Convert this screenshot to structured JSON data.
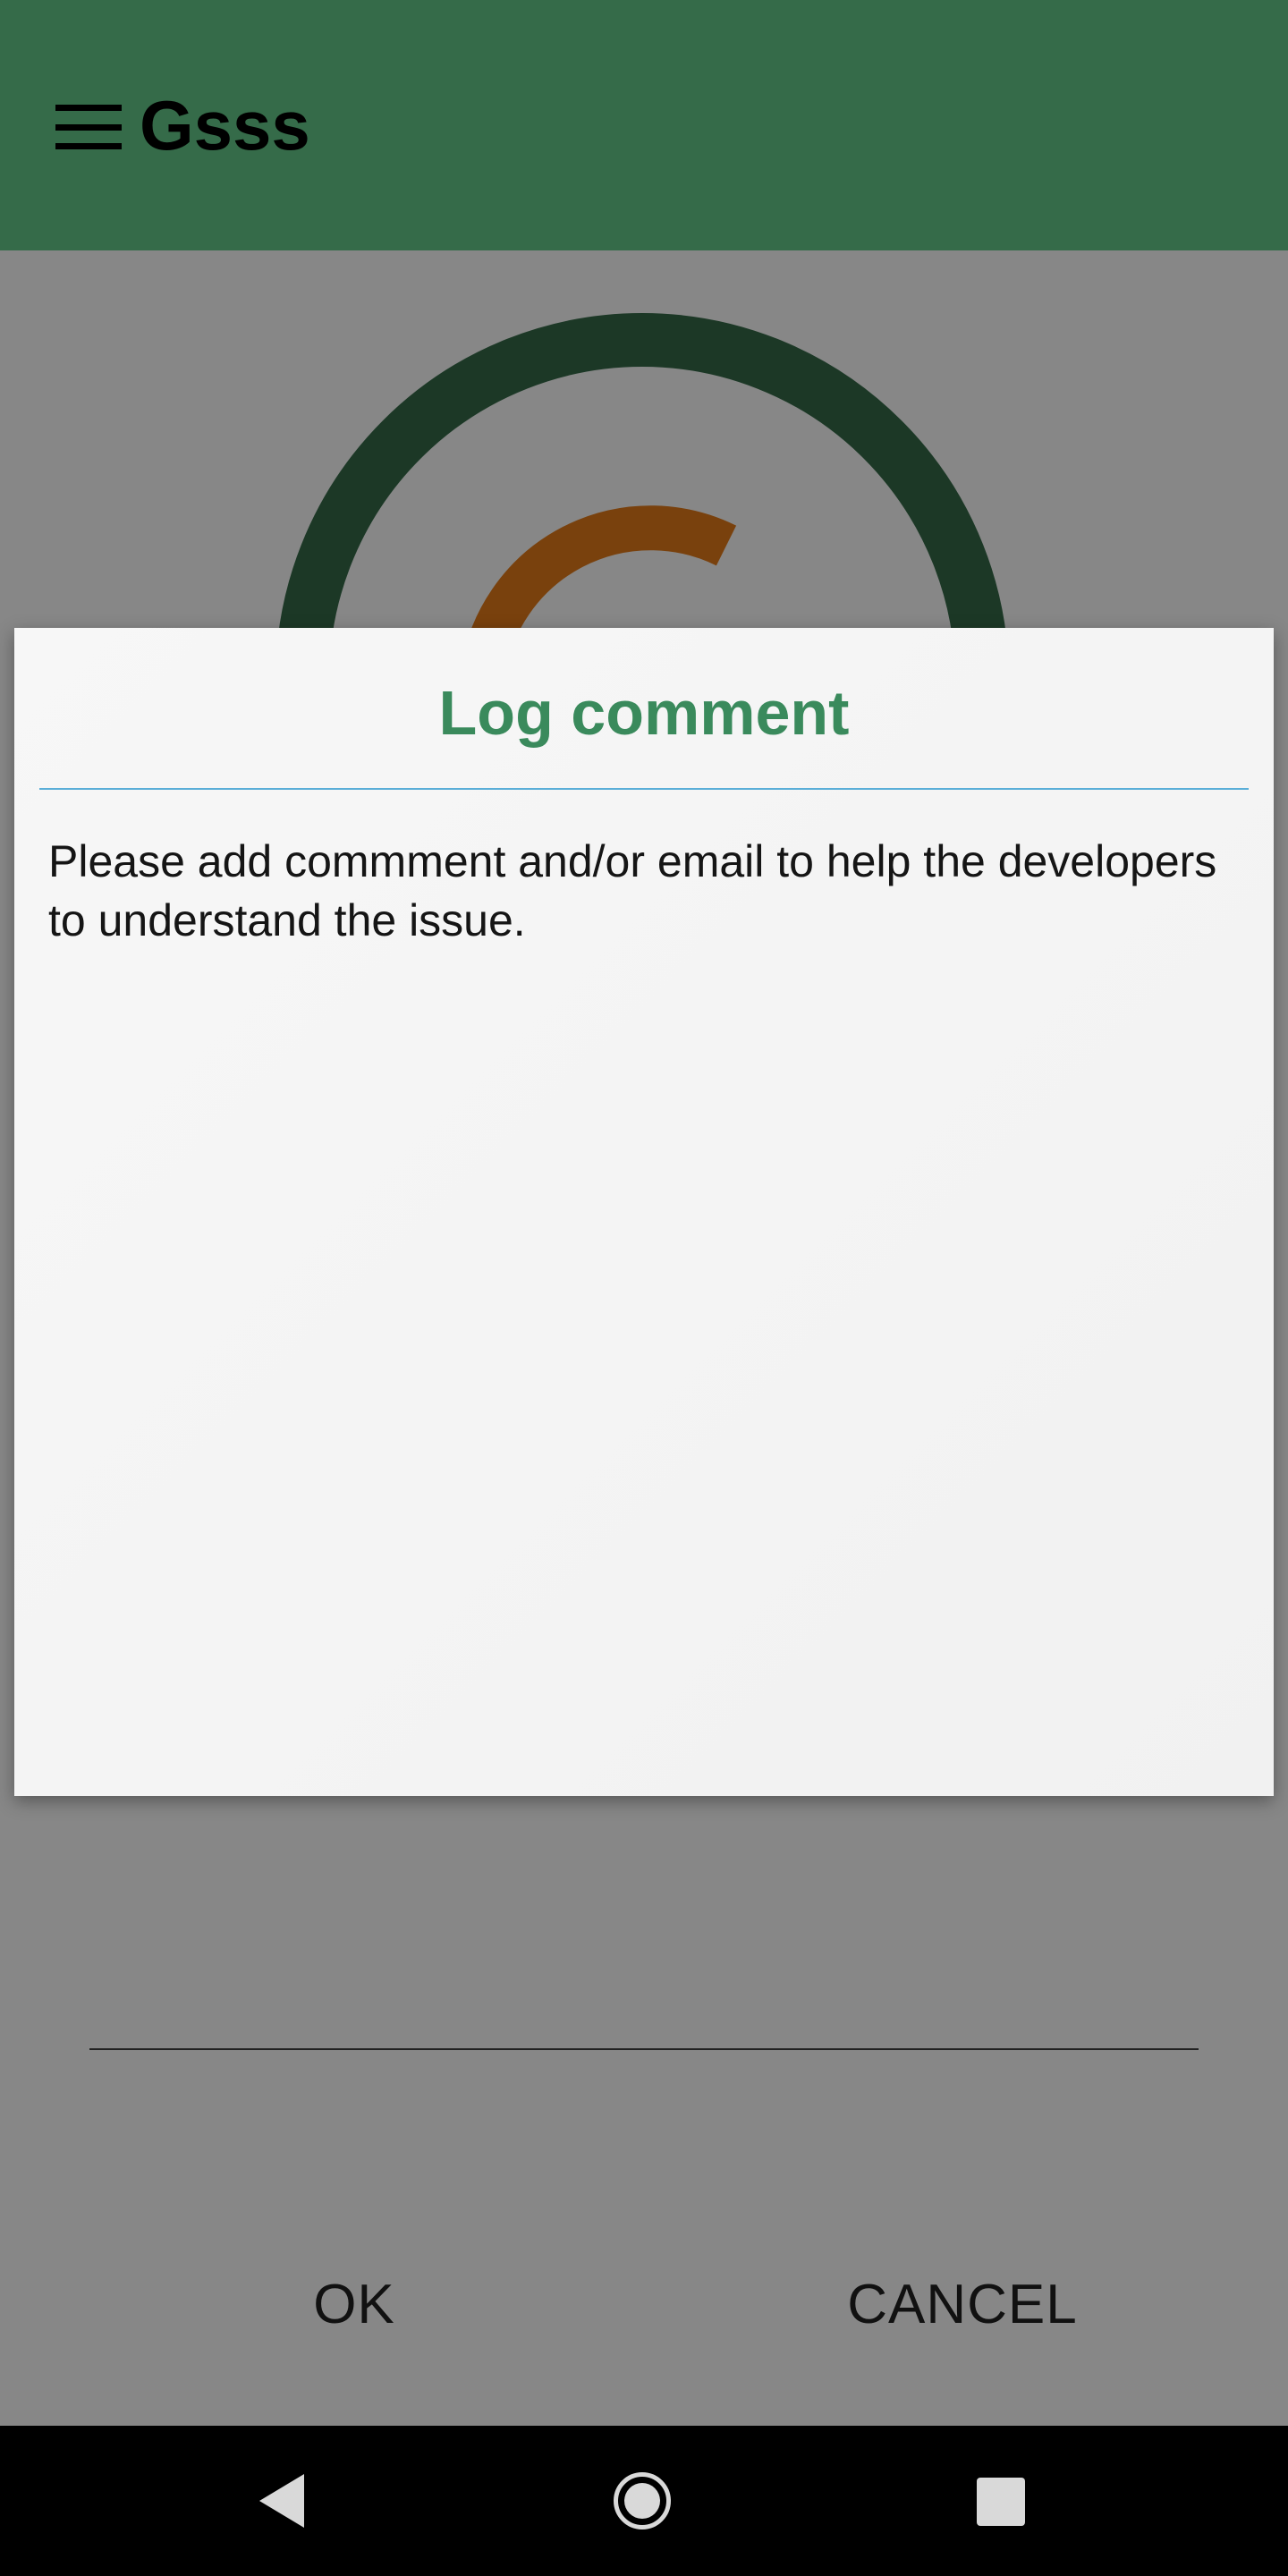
{
  "app_bar": {
    "title": "Gsss",
    "menu_icon": "hamburger-menu-icon",
    "background": "#356b49"
  },
  "gauge": {
    "outer_ring_color": "#356b49",
    "inner_arc_color": "#e57c1a"
  },
  "dialog": {
    "title": "Log comment",
    "title_color": "#3a8a5c",
    "message": "Please add commment and/or email to help the developers to understand the issue.",
    "comment_value": "",
    "comment_placeholder": "",
    "ok_label": "OK",
    "cancel_label": "CANCEL"
  },
  "nav_bar": {
    "back_icon": "back-triangle-icon",
    "home_icon": "home-circle-icon",
    "recent_icon": "recent-apps-square-icon"
  }
}
